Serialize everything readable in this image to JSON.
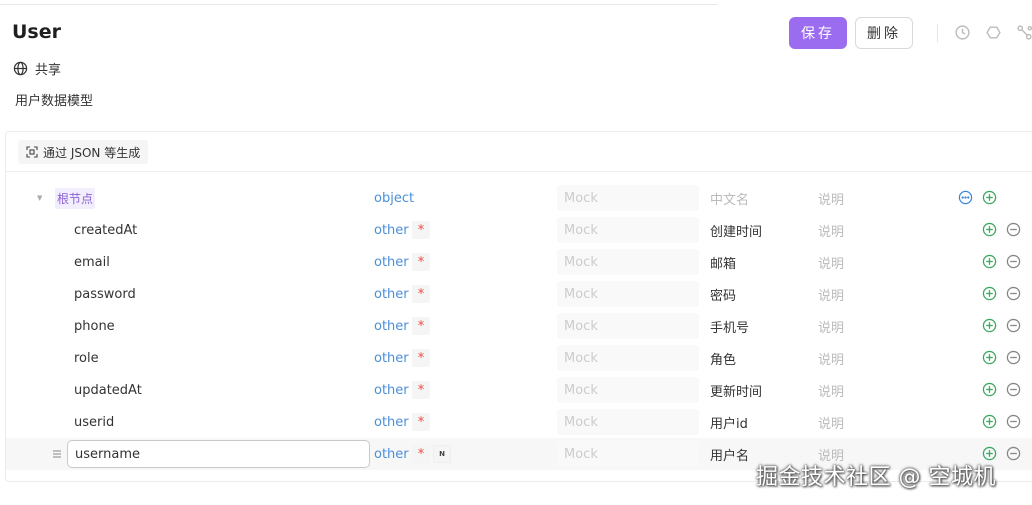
{
  "header": {
    "title": "User",
    "share_label": "共享",
    "description": "用户数据模型",
    "save_label": "保存",
    "delete_label": "删除"
  },
  "toolbar": {
    "generate_label": "通过 JSON 等生成"
  },
  "placeholders": {
    "mock": "Mock",
    "chinese_name": "中文名",
    "description": "说明"
  },
  "schema": {
    "root": {
      "name": "根节点",
      "type": "object"
    },
    "fields": [
      {
        "name": "createdAt",
        "type": "other",
        "required": "*",
        "chinese_name": "创建时间"
      },
      {
        "name": "email",
        "type": "other",
        "required": "*",
        "chinese_name": "邮箱"
      },
      {
        "name": "password",
        "type": "other",
        "required": "*",
        "chinese_name": "密码"
      },
      {
        "name": "phone",
        "type": "other",
        "required": "*",
        "chinese_name": "手机号"
      },
      {
        "name": "role",
        "type": "other",
        "required": "*",
        "chinese_name": "角色"
      },
      {
        "name": "updatedAt",
        "type": "other",
        "required": "*",
        "chinese_name": "更新时间"
      },
      {
        "name": "userid",
        "type": "other",
        "required": "*",
        "chinese_name": "用户id"
      },
      {
        "name": "username",
        "type": "other",
        "required": "*",
        "nullable_tag": "N",
        "chinese_name": "用户名"
      }
    ]
  },
  "watermark": "掘金技术社区 @ 空城机",
  "colors": {
    "primary": "#9b6cf0",
    "type_text": "#4a8fd8",
    "required": "#e8503a",
    "add_icon": "#3fa864",
    "root_tag_bg": "#f3eefd"
  }
}
